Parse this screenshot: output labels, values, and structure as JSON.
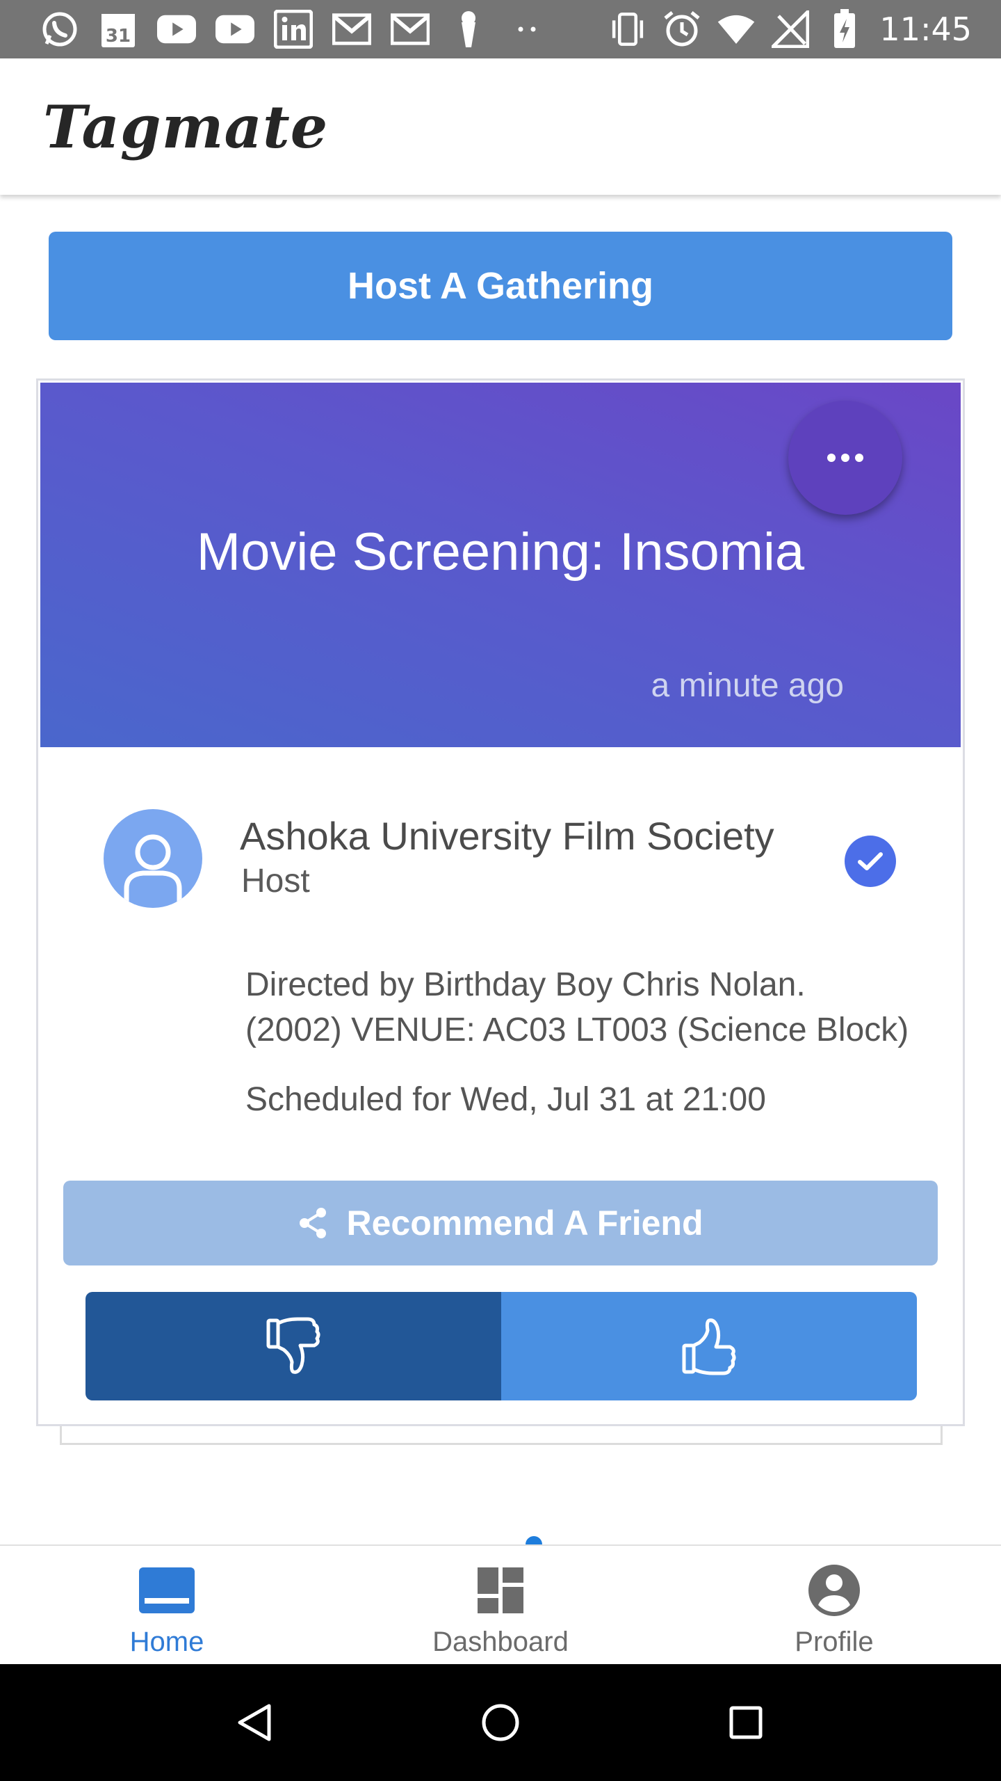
{
  "status_bar": {
    "time": "11:45",
    "left_icons": [
      "whatsapp-icon",
      "calendar-icon",
      "youtube-icon",
      "youtube-icon",
      "linkedin-icon",
      "gmail-icon",
      "gmail-icon",
      "location-pin-icon",
      "more-dots-icon"
    ],
    "right_icons": [
      "vibrate-icon",
      "alarm-icon",
      "wifi-icon",
      "no-signal-icon",
      "battery-charging-icon"
    ],
    "calendar_day": "31"
  },
  "header": {
    "brand": "Tagmate"
  },
  "host_button": {
    "label": "Host A Gathering"
  },
  "event": {
    "title": "Movie Screening: Insomia",
    "posted": "a minute ago",
    "host_name": "Ashoka University Film Society",
    "host_role": "Host",
    "description_line1": "Directed by Birthday Boy Chris Nolan.",
    "description_line2": "(2002) VENUE: AC03 LT003 (Science Block)",
    "schedule": "Scheduled for Wed, Jul 31 at 21:00",
    "recommend_label": "Recommend A Friend"
  },
  "bottom_nav": {
    "items": [
      {
        "label": "Home",
        "icon": "home-icon",
        "active": true
      },
      {
        "label": "Dashboard",
        "icon": "dashboard-icon",
        "active": false
      },
      {
        "label": "Profile",
        "icon": "profile-icon",
        "active": false
      }
    ]
  },
  "colors": {
    "primary": "#4a90e2",
    "dark_primary": "#225797",
    "hero_purple": "#6a47c6",
    "hero_blue": "#4a67cc",
    "verified": "#4c6ee8",
    "nav_active": "#2f7bd6"
  }
}
